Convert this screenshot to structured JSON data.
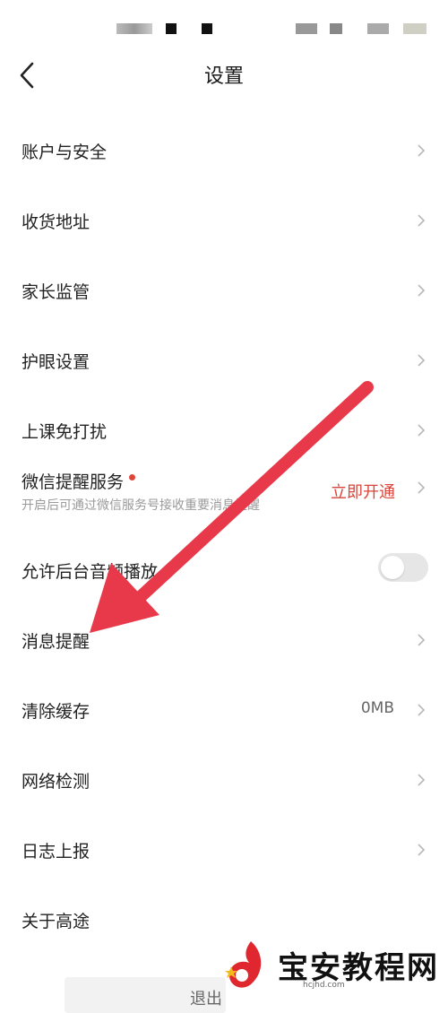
{
  "header": {
    "title": "设置"
  },
  "settings": {
    "items": [
      {
        "label": "账户与安全"
      },
      {
        "label": "收货地址"
      },
      {
        "label": "家长监管"
      },
      {
        "label": "护眼设置"
      },
      {
        "label": "上课免打扰"
      },
      {
        "label": "微信提醒服务",
        "subtitle": "开启后可通过微信服务号接收重要消息提醒",
        "action": "立即开通"
      },
      {
        "label": "允许后台音频播放",
        "toggle_on": false
      },
      {
        "label": "消息提醒"
      },
      {
        "label": "清除缓存",
        "value": "0MB"
      },
      {
        "label": "网络检测"
      },
      {
        "label": "日志上报"
      },
      {
        "label": "关于高途"
      }
    ]
  },
  "footer": {
    "logout_label": "退出"
  },
  "watermark": {
    "text": "宝安教程网",
    "url": "hcjhd.com"
  },
  "colors": {
    "accent_red": "#d9453a",
    "arrow": "#e8394a"
  }
}
